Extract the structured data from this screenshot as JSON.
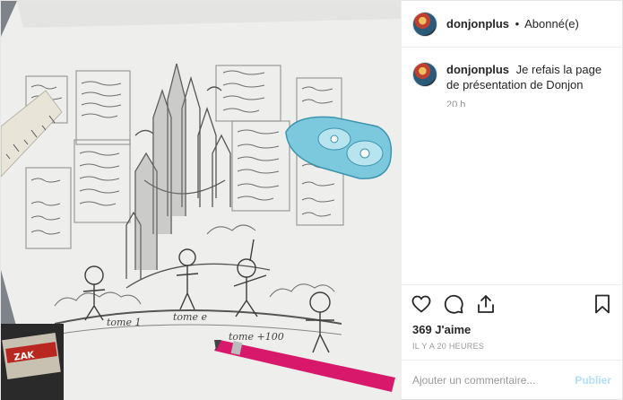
{
  "post": {
    "username": "donjonplus",
    "separator": "•",
    "follow_status": "Abonné(e)",
    "caption": "Je refais la page de présentation de Donjon",
    "caption_time": "20 h",
    "likes": "369 J'aime",
    "date": "IL Y A 20 HEURES",
    "comment_placeholder": "Ajouter un commentaire...",
    "publish_label": "Publier"
  },
  "photo": {
    "sketch_labels": {
      "tome1": "tome 1",
      "tome_e": "tome e",
      "tome_100": "tome +100"
    },
    "tape_label": "ZAK"
  },
  "icons": {
    "like": "heart-icon",
    "comment": "comment-icon",
    "share": "share-icon",
    "save": "bookmark-icon"
  },
  "colors": {
    "publish": "#b2dffc",
    "muted": "#8e8e8e"
  }
}
